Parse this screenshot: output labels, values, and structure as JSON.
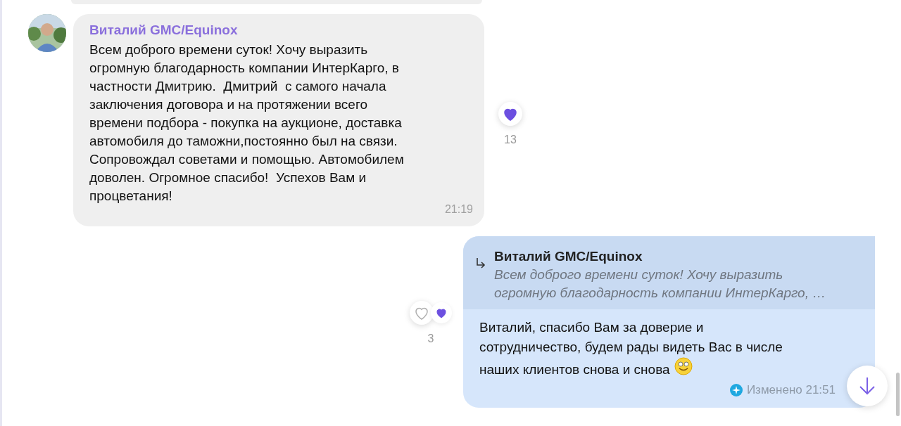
{
  "messages": [
    {
      "kind": "incoming",
      "author": "Виталий GMC/Equinox",
      "text": "Всем доброго времени суток! Хочу выразить\nогромную благодарность компании ИнтерКарго, в\nчастности Дмитрию.  Дмитрий  с самого начала\nзаключения договора и на протяжении всего\nвремени подбора - покупка на аукционе, доставка\nавтомобиля до таможни,постоянно был на связи.\nСопровождал советами и помощью. Автомобилем\nдоволен. Огромное спасибо!  Успехов Вам и\nпроцветания!",
      "time": "21:19",
      "reactions": [
        {
          "liked": true
        }
      ],
      "reaction_count": "13"
    },
    {
      "kind": "outgoing",
      "reply_to": {
        "author": "Виталий GMC/Equinox",
        "text": "Всем доброго времени суток! Хочу выразить\nогромную благодарность компании ИнтерКарго, …"
      },
      "text": "Виталий, спасибо Вам за доверие и\nсотрудничество, будем рады видеть Вас в числе\nнаших клиентов снова и снова",
      "emoji": true,
      "time": "Изменено 21:51",
      "reactions": [
        {
          "liked": false
        },
        {
          "liked": true
        }
      ],
      "reaction_count": "3"
    }
  ]
}
